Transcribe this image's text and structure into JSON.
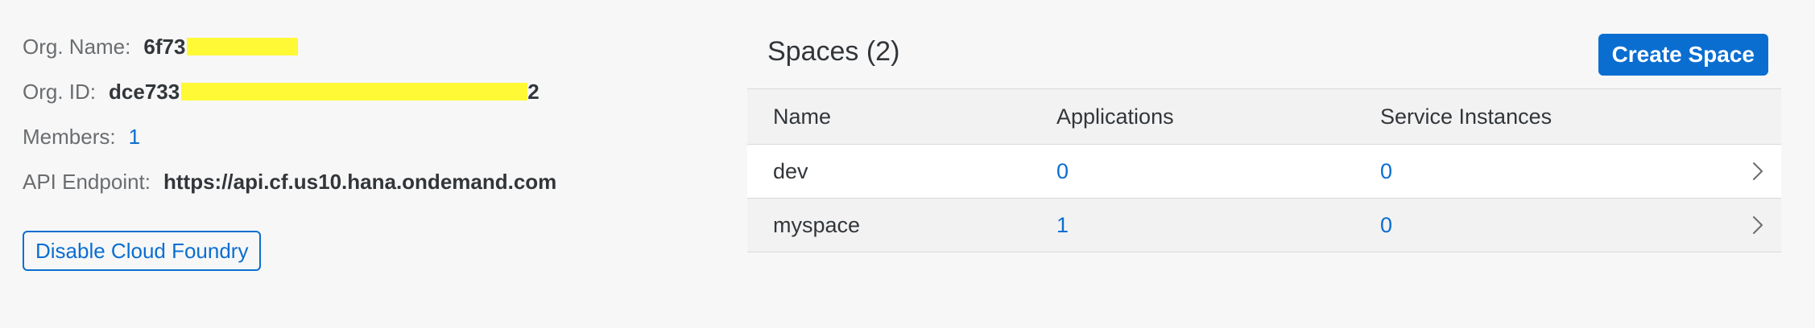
{
  "org": {
    "name_label": "Org. Name:",
    "name_value_visible": "6f73",
    "id_label": "Org. ID:",
    "id_value_visible": "dce733",
    "id_value_suffix_visible": "2",
    "members_label": "Members:",
    "members_value": "1",
    "api_label": "API Endpoint:",
    "api_value": "https://api.cf.us10.hana.ondemand.com",
    "disable_button_label": "Disable Cloud Foundry"
  },
  "spaces": {
    "title": "Spaces (2)",
    "create_button_label": "Create Space",
    "table": {
      "headers": [
        "Name",
        "Applications",
        "Service Instances"
      ],
      "rows": [
        {
          "name": "dev",
          "applications": "0",
          "service_instances": "0"
        },
        {
          "name": "myspace",
          "applications": "1",
          "service_instances": "0"
        }
      ]
    }
  },
  "colors": {
    "accent": "#0a6ed1",
    "redaction_highlight": "#fff936"
  },
  "icons": {
    "row_chevron": "chevron-right-icon"
  }
}
